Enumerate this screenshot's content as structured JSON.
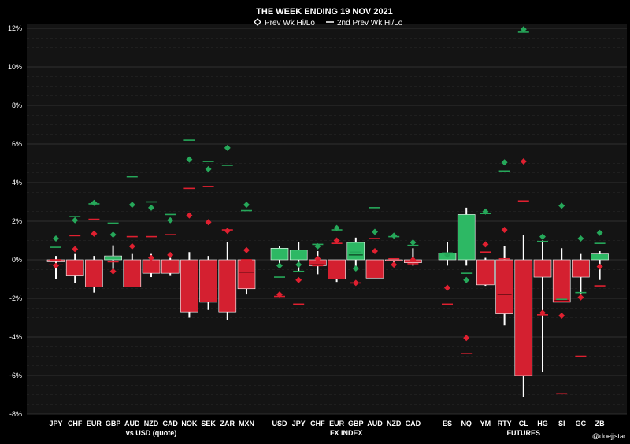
{
  "chart_data": {
    "type": "bar",
    "title": "THE WEEK ENDING  19 NOV 2021",
    "legend": {
      "placement": "top-center",
      "items": [
        {
          "label": "Prev Wk Hi/Lo",
          "marker": "diamond"
        },
        {
          "label": "2nd Prev Wk Hi/Lo",
          "marker": "dash"
        }
      ]
    },
    "y_axis": {
      "ylim": [
        -8,
        12
      ],
      "ticks": [
        12,
        10,
        8,
        6,
        4,
        2,
        0,
        -2,
        -4,
        -6,
        -8
      ],
      "tick_labels": [
        "12%",
        "10%",
        "8%",
        "6%",
        "4%",
        "2%",
        "0%",
        "-2%",
        "-4%",
        "-6%",
        "-8%"
      ],
      "grid": true
    },
    "colors": {
      "up": "#2db864",
      "down": "#d42030",
      "prev_hi": "#26a85a",
      "prev_lo": "#e02030",
      "wick": "#ffffff",
      "background": "#000000",
      "plot_background": "#141414"
    },
    "groups": [
      {
        "label": "vs USD (quote)",
        "categories": [
          {
            "name": "JPY",
            "open": 0,
            "close": -0.1,
            "high": 0.2,
            "low": -1.0,
            "mid": -0.25,
            "prev_hi": 1.1,
            "prev_lo": -0.3,
            "prev2_hi": 0.65,
            "prev2_lo": 0.0
          },
          {
            "name": "CHF",
            "open": 0,
            "close": -0.8,
            "high": 0.3,
            "low": -1.2,
            "mid": null,
            "prev_hi": 2.05,
            "prev_lo": 0.55,
            "prev2_hi": 2.25,
            "prev2_lo": 1.25
          },
          {
            "name": "EUR",
            "open": 0,
            "close": -1.4,
            "high": 0.2,
            "low": -1.7,
            "mid": null,
            "prev_hi": 2.95,
            "prev_lo": 1.35,
            "prev2_hi": 2.9,
            "prev2_lo": 2.1
          },
          {
            "name": "GBP",
            "open": 0,
            "close": 0.2,
            "high": 0.75,
            "low": -0.6,
            "mid": 0.15,
            "prev_hi": 1.3,
            "prev_lo": -0.6,
            "prev2_hi": 1.9,
            "prev2_lo": -0.1
          },
          {
            "name": "AUD",
            "open": 0,
            "close": -1.4,
            "high": 0.3,
            "low": -1.4,
            "mid": null,
            "prev_hi": 2.85,
            "prev_lo": 0.7,
            "prev2_hi": 4.3,
            "prev2_lo": 1.2
          },
          {
            "name": "NZD",
            "open": 0,
            "close": -0.7,
            "high": 0.3,
            "low": -0.9,
            "mid": null,
            "prev_hi": 2.7,
            "prev_lo": 0.1,
            "prev2_hi": 3.0,
            "prev2_lo": 1.2
          },
          {
            "name": "CAD",
            "open": 0,
            "close": -0.7,
            "high": 0.1,
            "low": -0.8,
            "mid": null,
            "prev_hi": 2.05,
            "prev_lo": 0.25,
            "prev2_hi": 2.35,
            "prev2_lo": 1.3
          },
          {
            "name": "NOK",
            "open": 0,
            "close": -2.7,
            "high": 0.4,
            "low": -3.0,
            "mid": null,
            "prev_hi": 5.2,
            "prev_lo": 2.3,
            "prev2_hi": 6.2,
            "prev2_lo": 3.7
          },
          {
            "name": "SEK",
            "open": 0,
            "close": -2.2,
            "high": 0.2,
            "low": -2.6,
            "mid": null,
            "prev_hi": 4.7,
            "prev_lo": 1.95,
            "prev2_hi": 5.1,
            "prev2_lo": 3.8
          },
          {
            "name": "ZAR",
            "open": 0,
            "close": -2.7,
            "high": 0.9,
            "low": -3.1,
            "mid": null,
            "prev_hi": 5.8,
            "prev_lo": 1.5,
            "prev2_hi": 4.9,
            "prev2_lo": 1.55
          },
          {
            "name": "MXN",
            "open": 0,
            "close": -1.5,
            "high": 0.0,
            "low": -1.8,
            "mid": -0.65,
            "prev_hi": 2.85,
            "prev_lo": 0.5,
            "prev2_hi": 2.55,
            "prev2_lo": 0.0
          }
        ]
      },
      {
        "label": "FX INDEX",
        "categories": [
          {
            "name": "USD",
            "open": 0,
            "close": 0.6,
            "high": 0.7,
            "low": -0.2,
            "mid": null,
            "prev_hi": -0.3,
            "prev_lo": -1.8,
            "prev2_hi": -0.9,
            "prev2_lo": -1.9
          },
          {
            "name": "JPY",
            "open": 0,
            "close": 0.5,
            "high": 0.9,
            "low": -0.6,
            "mid": null,
            "prev_hi": -0.25,
            "prev_lo": -1.05,
            "prev2_hi": -0.6,
            "prev2_lo": -2.3
          },
          {
            "name": "CHF",
            "open": 0,
            "close": -0.3,
            "high": 0.45,
            "low": -0.75,
            "mid": -0.25,
            "prev_hi": 0.7,
            "prev_lo": 0.05,
            "prev2_hi": 0.8,
            "prev2_lo": -0.3
          },
          {
            "name": "EUR",
            "open": 0,
            "close": -1.0,
            "high": 0.0,
            "low": -1.15,
            "mid": null,
            "prev_hi": 1.65,
            "prev_lo": 1.0,
            "prev2_hi": 1.55,
            "prev2_lo": 0.85
          },
          {
            "name": "GBP",
            "open": 0,
            "close": 0.9,
            "high": 1.15,
            "low": -0.35,
            "mid": 0.25,
            "prev_hi": -0.45,
            "prev_lo": -1.2,
            "prev2_hi": 0.4,
            "prev2_lo": -1.2
          },
          {
            "name": "AUD",
            "open": 0,
            "close": -0.95,
            "high": 0.0,
            "low": -0.95,
            "mid": null,
            "prev_hi": 1.45,
            "prev_lo": 0.45,
            "prev2_hi": 2.7,
            "prev2_lo": 1.1
          },
          {
            "name": "NZD",
            "open": 0,
            "close": -0.05,
            "high": 0.0,
            "low": -0.3,
            "mid": null,
            "prev_hi": 1.25,
            "prev_lo": -0.25,
            "prev2_hi": 1.2,
            "prev2_lo": 0.05
          },
          {
            "name": "CAD",
            "open": 0,
            "close": -0.15,
            "high": 0.6,
            "low": -0.3,
            "mid": null,
            "prev_hi": 0.9,
            "prev_lo": 0.0,
            "prev2_hi": 0.75,
            "prev2_lo": -0.2
          }
        ]
      },
      {
        "label": "FUTURES",
        "categories": [
          {
            "name": "ES",
            "open": 0,
            "close": 0.35,
            "high": 0.9,
            "low": -0.3,
            "mid": null,
            "prev_hi": 0.25,
            "prev_lo": -1.45,
            "prev2_hi": 0.35,
            "prev2_lo": -2.3
          },
          {
            "name": "NQ",
            "open": 0,
            "close": 2.35,
            "high": 2.7,
            "low": -0.3,
            "mid": null,
            "prev_hi": -1.05,
            "prev_lo": -4.05,
            "prev2_hi": -0.7,
            "prev2_lo": -4.85
          },
          {
            "name": "YM",
            "open": 0,
            "close": -1.3,
            "high": 0.1,
            "low": -1.35,
            "mid": null,
            "prev_hi": 2.5,
            "prev_lo": 0.8,
            "prev2_hi": 2.4,
            "prev2_lo": 0.4
          },
          {
            "name": "RTY",
            "open": 0,
            "close": -2.8,
            "high": 0.7,
            "low": -3.4,
            "mid": -1.8,
            "prev_hi": 5.05,
            "prev_lo": 1.55,
            "prev2_hi": 4.6,
            "prev2_lo": 0.05
          },
          {
            "name": "CL",
            "open": 0,
            "close": -6.0,
            "high": 1.3,
            "low": -7.1,
            "mid": null,
            "prev_hi": 11.95,
            "prev_lo": 5.1,
            "prev2_hi": 11.8,
            "prev2_lo": 3.05
          },
          {
            "name": "HG",
            "open": 0,
            "close": -0.9,
            "high": 1.0,
            "low": -5.8,
            "mid": null,
            "prev_hi": 1.2,
            "prev_lo": -2.75,
            "prev2_hi": 0.95,
            "prev2_lo": -2.85
          },
          {
            "name": "SI",
            "open": 0,
            "close": -2.2,
            "high": 0.6,
            "low": -2.2,
            "mid": -2.1,
            "prev_hi": 2.8,
            "prev_lo": -2.9,
            "prev2_hi": -2.05,
            "prev2_lo": -6.95
          },
          {
            "name": "GC",
            "open": 0,
            "close": -0.9,
            "high": 0.3,
            "low": -1.8,
            "mid": null,
            "prev_hi": 1.1,
            "prev_lo": -1.95,
            "prev2_hi": -1.7,
            "prev2_lo": -5.0
          },
          {
            "name": "ZB",
            "open": 0,
            "close": 0.3,
            "high": 0.45,
            "low": -1.05,
            "mid": null,
            "prev_hi": 1.4,
            "prev_lo": -0.35,
            "prev2_hi": 0.85,
            "prev2_lo": -1.35
          }
        ]
      }
    ],
    "credit": "@doejjstar"
  }
}
